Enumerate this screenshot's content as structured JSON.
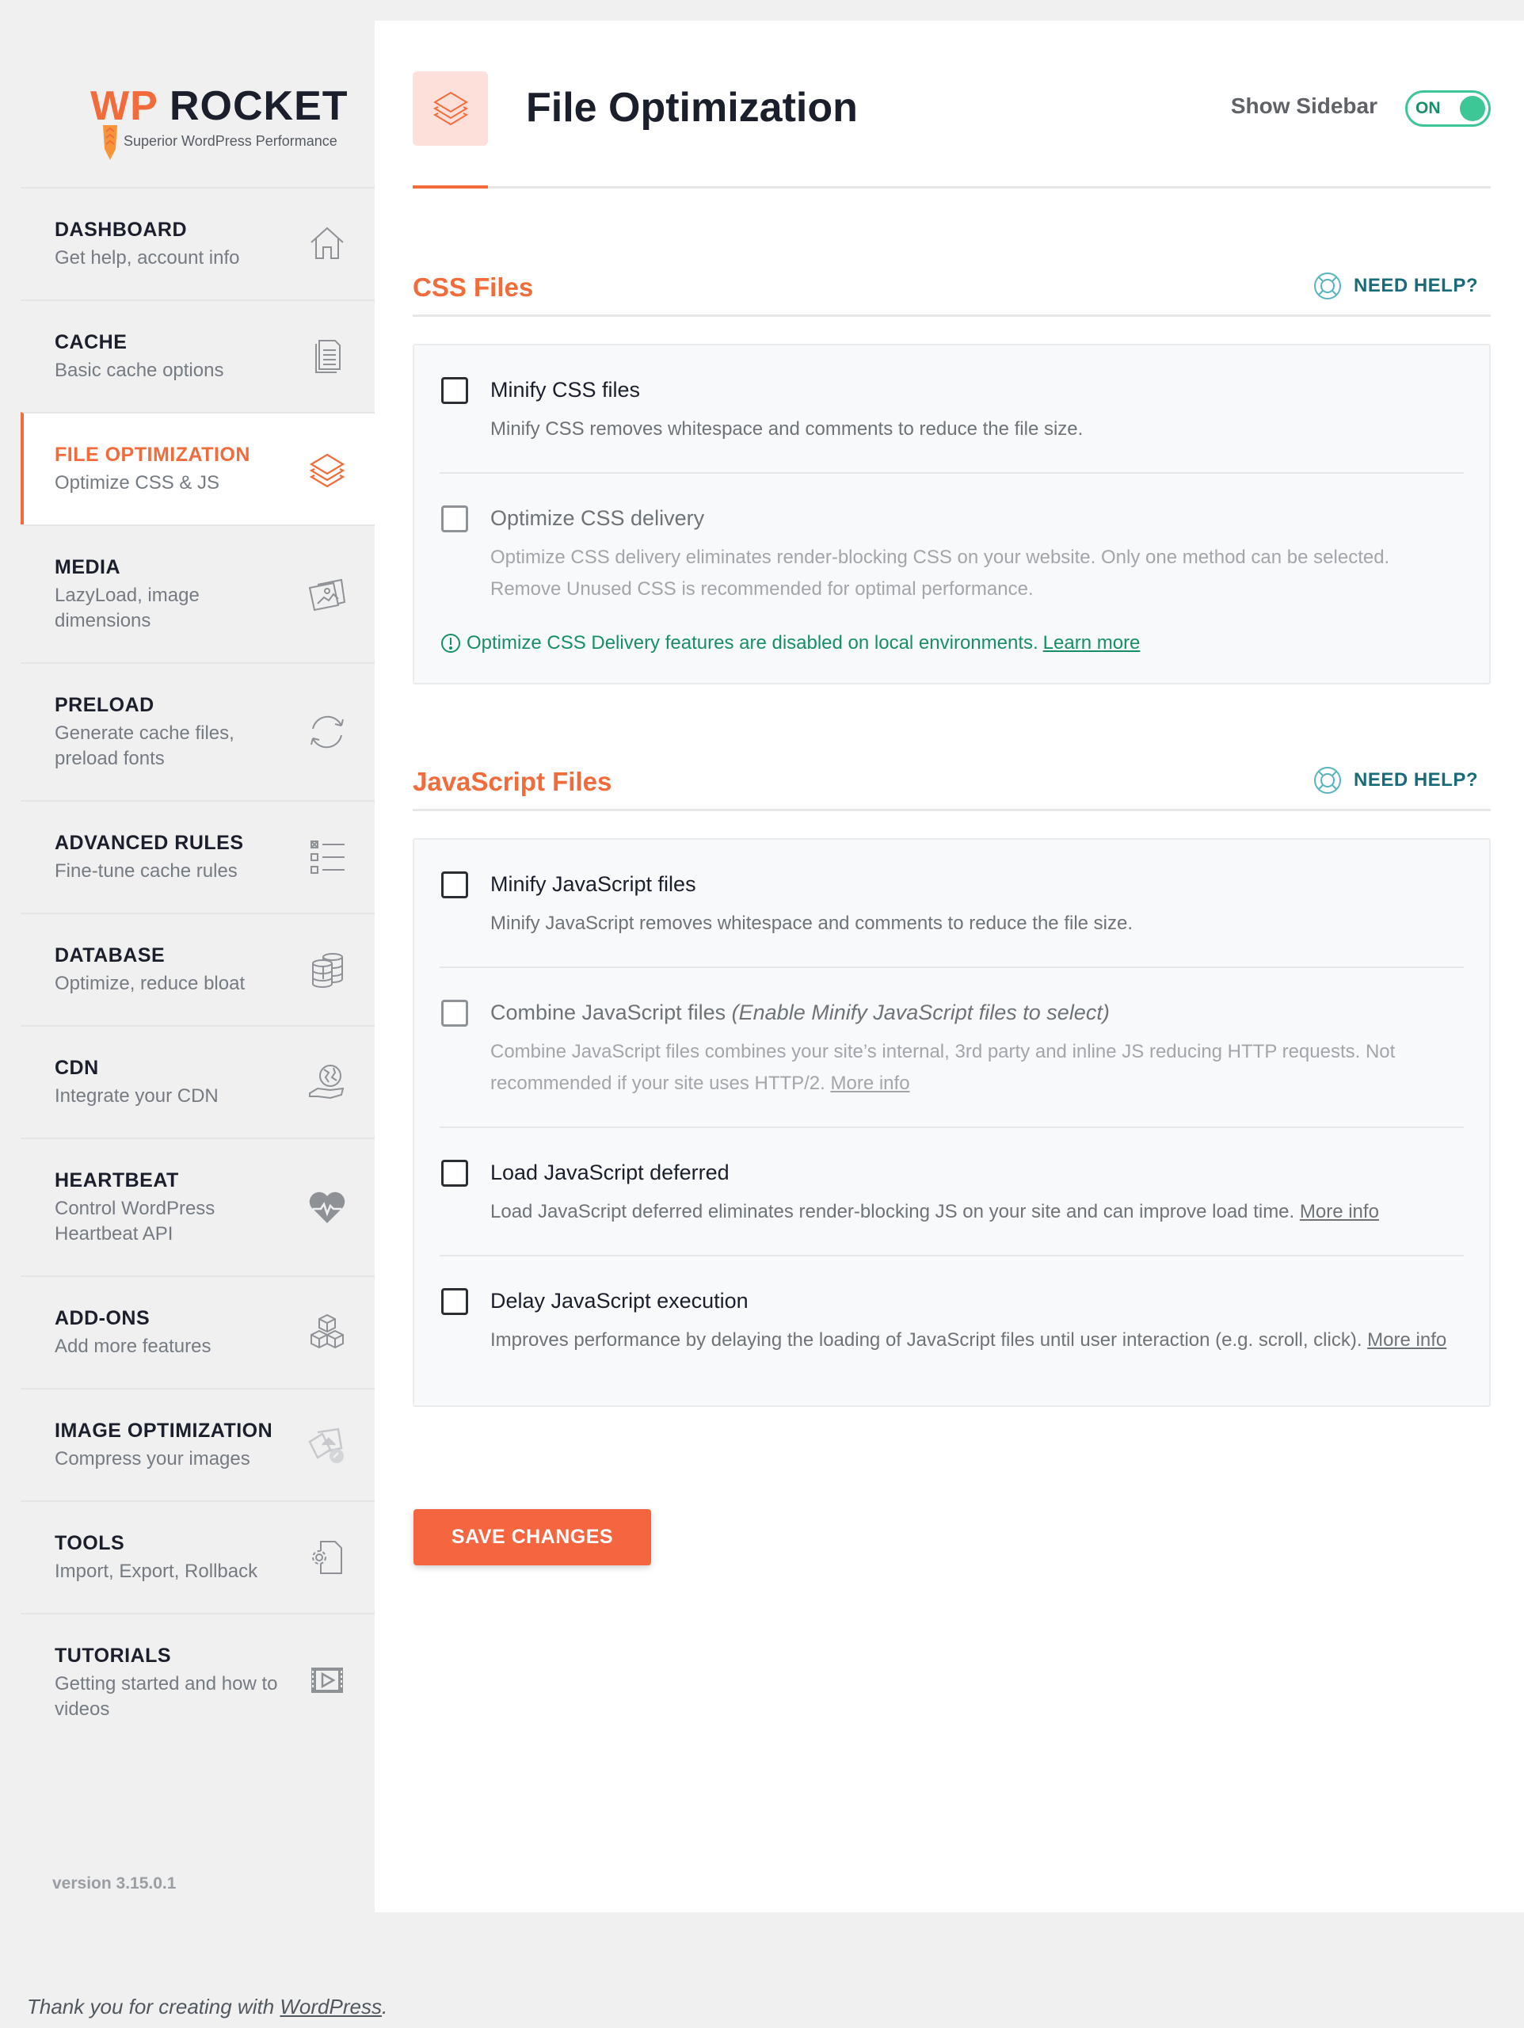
{
  "logo": {
    "brand_wp": "WP",
    "brand_rocket": "ROCKET",
    "tagline": "Superior WordPress Performance"
  },
  "sidebar": {
    "items": [
      {
        "title": "DASHBOARD",
        "subtitle": "Get help, account info",
        "icon": "home-icon",
        "active": false
      },
      {
        "title": "CACHE",
        "subtitle": "Basic cache options",
        "icon": "document-icon",
        "active": false
      },
      {
        "title": "FILE OPTIMIZATION",
        "subtitle": "Optimize CSS & JS",
        "icon": "layers-icon",
        "active": true
      },
      {
        "title": "MEDIA",
        "subtitle": "LazyLoad, image dimensions",
        "icon": "images-icon",
        "active": false
      },
      {
        "title": "PRELOAD",
        "subtitle": "Generate cache files, preload fonts",
        "icon": "refresh-icon",
        "active": false
      },
      {
        "title": "ADVANCED RULES",
        "subtitle": "Fine-tune cache rules",
        "icon": "checklist-icon",
        "active": false
      },
      {
        "title": "DATABASE",
        "subtitle": "Optimize, reduce bloat",
        "icon": "database-icon",
        "active": false
      },
      {
        "title": "CDN",
        "subtitle": "Integrate your CDN",
        "icon": "globe-hand-icon",
        "active": false
      },
      {
        "title": "HEARTBEAT",
        "subtitle": "Control WordPress Heartbeat API",
        "icon": "heartbeat-icon",
        "active": false
      },
      {
        "title": "ADD-ONS",
        "subtitle": "Add more features",
        "icon": "cubes-icon",
        "active": false
      },
      {
        "title": "IMAGE OPTIMIZATION",
        "subtitle": "Compress your images",
        "icon": "image-compress-icon",
        "active": false
      },
      {
        "title": "TOOLS",
        "subtitle": "Import, Export, Rollback",
        "icon": "file-gear-icon",
        "active": false
      },
      {
        "title": "TUTORIALS",
        "subtitle": "Getting started and how to videos",
        "icon": "video-icon",
        "active": false
      }
    ],
    "version": "version 3.15.0.1"
  },
  "header": {
    "title": "File Optimization",
    "icon": "layers-icon",
    "show_sidebar_label": "Show Sidebar",
    "toggle_state": "ON"
  },
  "sections": {
    "css": {
      "title": "CSS Files",
      "help_label": "NEED HELP?",
      "options": [
        {
          "label": "Minify CSS files",
          "description": "Minify CSS removes whitespace and comments to reduce the file size.",
          "checked": false,
          "disabled": false
        },
        {
          "label": "Optimize CSS delivery",
          "description": "Optimize CSS delivery eliminates render-blocking CSS on your website. Only one method can be selected. Remove Unused CSS is recommended for optimal performance.",
          "checked": false,
          "disabled": true
        }
      ],
      "notice": {
        "text": "Optimize CSS Delivery features are disabled on local environments.",
        "link": "Learn more"
      }
    },
    "js": {
      "title": "JavaScript Files",
      "help_label": "NEED HELP?",
      "options": [
        {
          "label": "Minify JavaScript files",
          "description": "Minify JavaScript removes whitespace and comments to reduce the file size.",
          "checked": false,
          "disabled": false
        },
        {
          "label": "Combine JavaScript files",
          "note": "(Enable Minify JavaScript files to select)",
          "description": "Combine JavaScript files combines your site’s internal, 3rd party and inline JS reducing HTTP requests. Not recommended if your site uses HTTP/2.",
          "link": "More info",
          "checked": false,
          "disabled": true
        },
        {
          "label": "Load JavaScript deferred",
          "description": "Load JavaScript deferred eliminates render-blocking JS on your site and can improve load time.",
          "link": "More info",
          "checked": false,
          "disabled": false
        },
        {
          "label": "Delay JavaScript execution",
          "description": "Improves performance by delaying the loading of JavaScript files until user interaction (e.g. scroll, click).",
          "link": "More info",
          "checked": false,
          "disabled": false
        }
      ]
    }
  },
  "save_label": "SAVE CHANGES",
  "footer": {
    "text": "Thank you for creating with ",
    "link": "WordPress",
    "suffix": "."
  },
  "colors": {
    "accent": "#f26b3a",
    "toggle_on": "#3ec796",
    "help_text": "#1a6b78",
    "notice": "#178e6a",
    "save_button": "#f56640"
  }
}
